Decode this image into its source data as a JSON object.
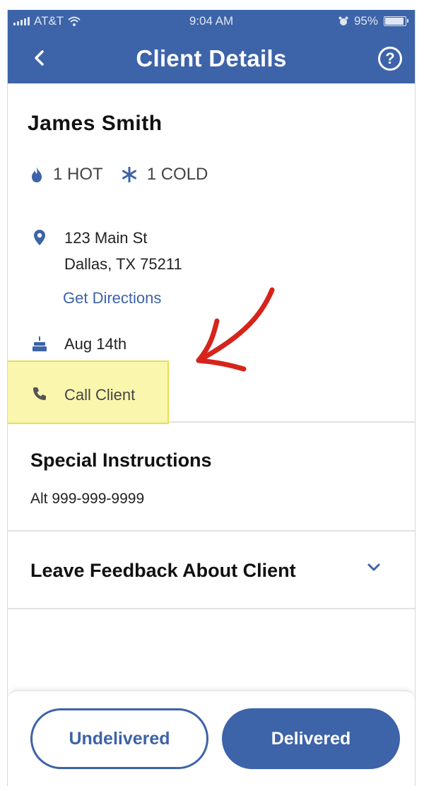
{
  "status_bar": {
    "carrier": "AT&T",
    "time": "9:04 AM",
    "battery": "95%"
  },
  "nav": {
    "title": "Client Details",
    "back_icon": "chevron-left-icon",
    "help_icon": "help-circle-icon",
    "help_glyph": "?"
  },
  "client": {
    "name": "James Smith",
    "hot_label": "1 HOT",
    "cold_label": "1 COLD",
    "address_line1": "123 Main St",
    "address_line2": "Dallas, TX 75211",
    "directions_label": "Get Directions",
    "birthday": "Aug 14th",
    "call_label": "Call Client"
  },
  "special": {
    "title": "Special Instructions",
    "text": "Alt 999-999-9999"
  },
  "feedback": {
    "title": "Leave Feedback About Client"
  },
  "buttons": {
    "undelivered": "Undelivered",
    "delivered": "Delivered"
  },
  "colors": {
    "brand": "#3d63a8",
    "annotation_arrow": "#d6241c",
    "highlight": "#faf5a0"
  }
}
